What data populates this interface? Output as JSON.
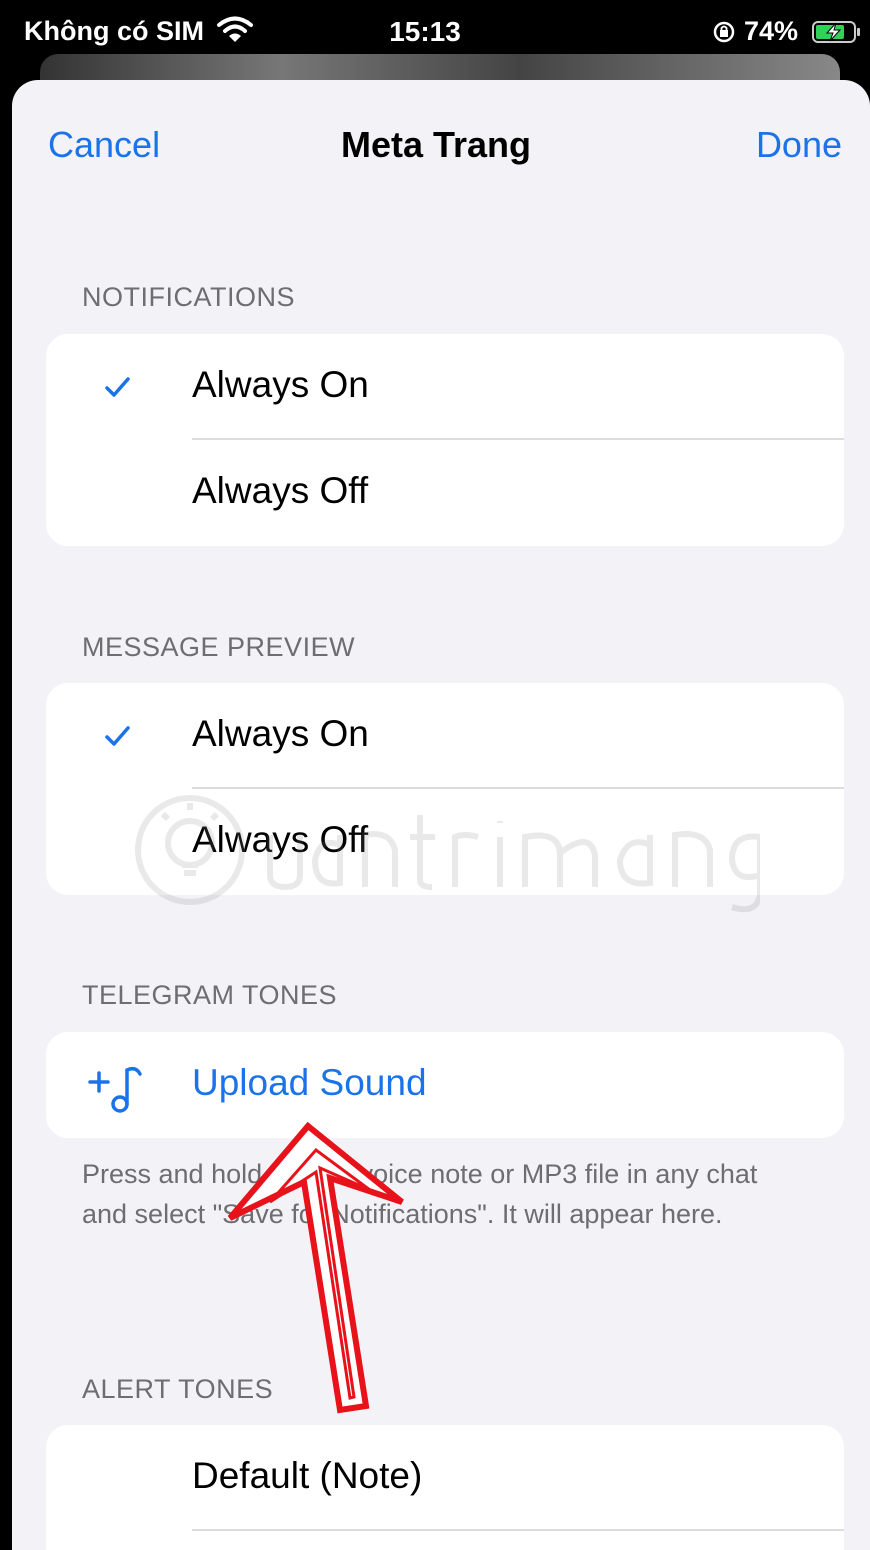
{
  "status_bar": {
    "carrier": "Không có SIM",
    "time": "15:13",
    "battery_percent": "74%",
    "icons": [
      "wifi-icon",
      "orientation-lock-icon",
      "battery-charging-icon"
    ]
  },
  "nav": {
    "cancel_label": "Cancel",
    "title": "Meta Trang",
    "done_label": "Done"
  },
  "notifications": {
    "header": "NOTIFICATIONS",
    "options": [
      {
        "label": "Always On",
        "selected": true
      },
      {
        "label": "Always Off",
        "selected": false
      }
    ]
  },
  "message_preview": {
    "header": "MESSAGE PREVIEW",
    "options": [
      {
        "label": "Always On",
        "selected": true
      },
      {
        "label": "Always Off",
        "selected": false
      }
    ]
  },
  "telegram_tones": {
    "header": "TELEGRAM TONES",
    "upload_label": "Upload Sound",
    "upload_icon": "add-music-icon",
    "footer": "Press and hold a short voice note or MP3 file in any chat and select \"Save for Notifications\". It will appear here."
  },
  "alert_tones": {
    "header": "ALERT TONES",
    "options": [
      {
        "label": "Default (Note)"
      }
    ]
  },
  "colors": {
    "accent": "#1a73e8",
    "background": "#f2f2f7",
    "annotation_arrow": "#e8121b"
  }
}
